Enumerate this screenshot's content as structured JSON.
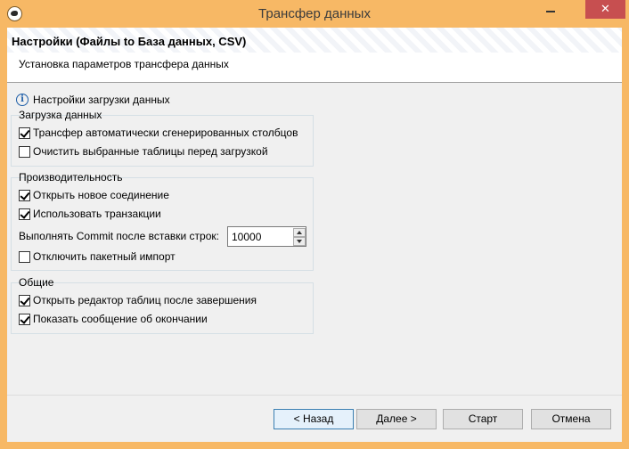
{
  "window": {
    "title": "Трансфер данных",
    "close_glyph": "✕"
  },
  "header": {
    "title": "Настройки (Файлы to База данных, CSV)",
    "subtitle": "Установка параметров трансфера данных"
  },
  "info": {
    "icon": "info-icon",
    "icon_glyph": "i",
    "label": "Настройки загрузки данных"
  },
  "groups": {
    "load": {
      "title": "Загрузка данных",
      "items": [
        {
          "label": "Трансфер автоматически сгенерированных столбцов",
          "checked": true
        },
        {
          "label": "Очистить выбранные таблицы перед загрузкой",
          "checked": false
        }
      ]
    },
    "performance": {
      "title": "Производительность",
      "items": [
        {
          "label": "Открыть новое соединение",
          "checked": true
        },
        {
          "label": "Использовать транзакции",
          "checked": true
        },
        {
          "label": "Отключить пакетный импорт",
          "checked": false
        }
      ],
      "commit_label": "Выполнять Commit после вставки строк:",
      "commit_value": "10000"
    },
    "general": {
      "title": "Общие",
      "items": [
        {
          "label": "Открыть редактор таблиц после завершения",
          "checked": true
        },
        {
          "label": "Показать сообщение об окончании",
          "checked": true
        }
      ]
    }
  },
  "buttons": {
    "back": "< Назад",
    "next": "Далее >",
    "start": "Старт",
    "cancel": "Отмена"
  },
  "colors": {
    "title_bar": "#f7b865",
    "close_button": "#c74f50",
    "primary_border": "#3c7fb1"
  }
}
